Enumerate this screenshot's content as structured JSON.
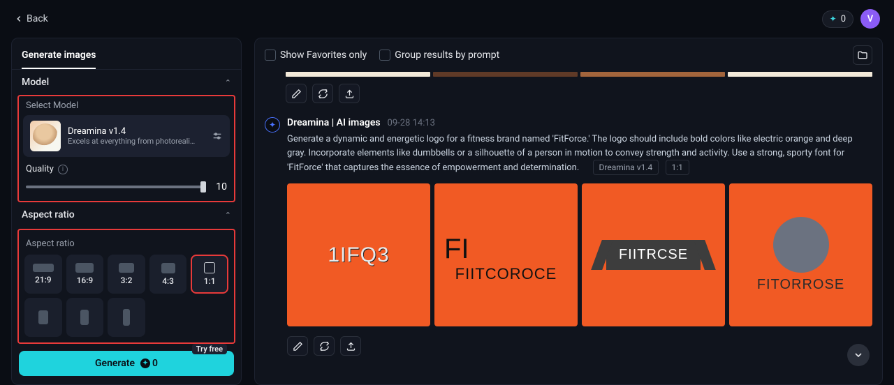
{
  "topbar": {
    "back_label": "Back",
    "credits": "0",
    "avatar_initial": "V"
  },
  "sidebar": {
    "tab_label": "Generate images",
    "model": {
      "section_title": "Model",
      "select_label": "Select Model",
      "name": "Dreamina v1.4",
      "desc": "Excels at everything from photoreali…"
    },
    "quality": {
      "label": "Quality",
      "value": "10"
    },
    "aspect": {
      "section_title": "Aspect ratio",
      "sublabel": "Aspect ratio",
      "options": [
        "21:9",
        "16:9",
        "3:2",
        "4:3",
        "1:1"
      ]
    },
    "generate": {
      "label": "Generate",
      "cost": "0",
      "tryfree": "Try free"
    }
  },
  "main": {
    "filters": {
      "favorites": "Show Favorites only",
      "group": "Group results by prompt"
    },
    "swatches": [
      "#f3ead9",
      "#5f3a27",
      "#a3653c",
      "#f3ead9"
    ],
    "generation": {
      "title": "Dreamina | AI images",
      "meta": "09-28  14:13",
      "prompt": "Generate a dynamic and energetic logo for a fitness brand named 'FitForce.' The logo should include bold colors like electric orange and deep gray. Incorporate elements like dumbbells or a silhouette of a person in motion to convey strength and activity. Use a strong, sporty font for 'FitForce' that captures the essence of empowerment and determination.",
      "tag_model": "Dreamina v1.4",
      "tag_ratio": "1:1",
      "tiles": {
        "t1": "1IFQ3",
        "t2": "FIITCOROCE",
        "t3": "FIITRCSE",
        "t4": "FITORROSE"
      }
    }
  }
}
